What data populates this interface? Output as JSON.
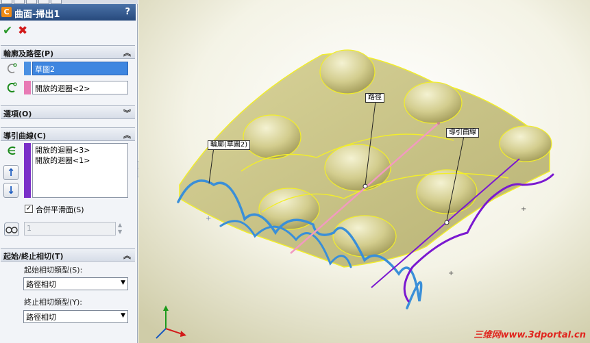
{
  "feature": {
    "title": "曲面-掃出1",
    "help": "?",
    "ok": "✔",
    "cancel": "✖"
  },
  "profile_path": {
    "header": "輪廓及路徑(P)",
    "profile_value": "草圖2",
    "path_value": "開放的迴圈<2>",
    "profile_color": "#4a90e2",
    "path_color": "#e87ab5"
  },
  "options": {
    "header": "選項(O)"
  },
  "guide_curves": {
    "header": "導引曲線(C)",
    "items": [
      "開放的迴圈<3>",
      "開放的迴圈<1>"
    ],
    "color": "#7a2fc8",
    "up": "↑",
    "down": "↓",
    "merge_label": "合併平滑面(S)",
    "merge_check": "✓",
    "count_value": "1"
  },
  "tangency": {
    "header": "起始/終止相切(T)",
    "start_label": "起始相切類型(S):",
    "start_value": "路徑相切",
    "end_label": "終止相切類型(Y):",
    "end_value": "路徑相切"
  },
  "viewport": {
    "callout_path": "路徑",
    "callout_profile": "輪廓(草圖2)",
    "callout_guide": "導引曲線",
    "watermark": "三维网www.3dportal.cn",
    "surface_color": "#d9d49a",
    "edge_color": "#f2ee2a",
    "profile_curve_color": "#3a8fd8",
    "guide_curve_color": "#7a18d0",
    "path_curve_color": "#f29ac0"
  }
}
